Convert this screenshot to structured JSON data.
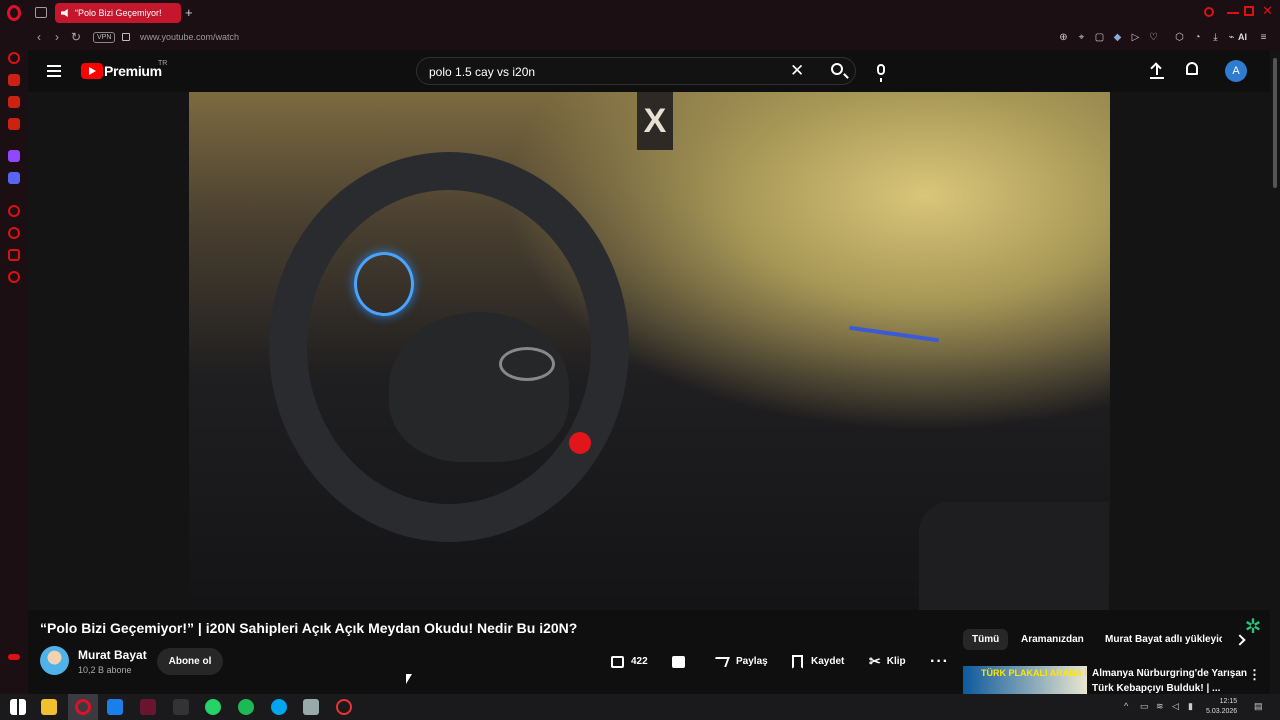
{
  "browser": {
    "tab_title": "“Polo Bizi Geçemiyor!",
    "new_tab": "+",
    "vpn": "VPN",
    "url": "www.youtube.com/watch",
    "ai_label": "AI"
  },
  "header": {
    "brand": "Premium",
    "country": "TR",
    "search_query": "polo 1.5 cay vs i20n",
    "avatar_letter": "A"
  },
  "video": {
    "overlay_sign": "X",
    "title": "“Polo Bizi Geçemiyor!” | i20N Sahipleri Açık Açık Meydan Okudu! Nedir Bu i20N?",
    "channel_name": "Murat Bayat",
    "subscribers": "10,2 B abone",
    "subscribe_label": "Abone ol",
    "likes": "422",
    "share_label": "Paylaş",
    "save_label": "Kaydet",
    "clip_label": "Klip",
    "more_label": "···"
  },
  "chips": [
    "Tümü",
    "Aramanızdan",
    "Murat Bayat adlı yükleyic"
  ],
  "recommended": {
    "thumb_text": "TÜRK PLAKALI ARABA İLE NÜRBURGRİNG TURU!",
    "title_line1": "Almanya Nürburgring'de Yarışan",
    "title_line2": "Türk Kebapçıyı Bulduk! | ...",
    "more": "⋮"
  },
  "taskbar": {
    "time": "12:15",
    "date": "5.03.2026"
  },
  "colors": {
    "opera_red": "#c4162c",
    "youtube_red": "#ff0000",
    "background": "#0f0f0f"
  },
  "icons": [
    "opera-icon",
    "tab-switcher-icon",
    "speaker-icon",
    "back-icon",
    "forward-icon",
    "reload-icon",
    "lock-icon",
    "zoom-icon",
    "bookmark-icon",
    "shield-icon",
    "play-icon",
    "heart-icon",
    "extensions-icon",
    "download-icon",
    "menu-icon",
    "search-icon",
    "mic-icon",
    "upload-icon",
    "bell-icon",
    "like-icon",
    "dislike-icon",
    "share-icon",
    "save-icon",
    "clip-icon",
    "gemini-icon",
    "windows-start-icon"
  ]
}
